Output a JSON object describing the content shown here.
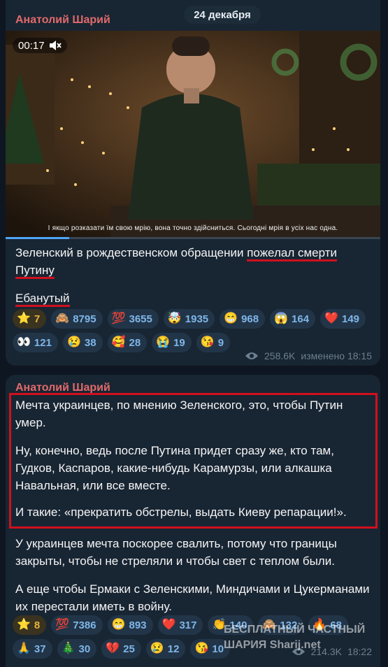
{
  "date": "24 декабря",
  "post1": {
    "sender": "Анатолий Шарий",
    "video_time": "00:17",
    "video_caption": "І якщо розказати їм свою мрію, вона точно здійсниться. Сьогодні мрія в усіх нас одна.",
    "text_a": "Зеленский в рождественском обращении ",
    "text_b": "пожелал смерти",
    "text_c": "Путину",
    "text_d": "Ебанутый",
    "reactions": [
      {
        "e": "⭐",
        "n": "7",
        "paid": true
      },
      {
        "e": "🙈",
        "n": "8795"
      },
      {
        "e": "💯",
        "n": "3655"
      },
      {
        "e": "🤯",
        "n": "1935"
      },
      {
        "e": "😁",
        "n": "968"
      },
      {
        "e": "😱",
        "n": "164"
      },
      {
        "e": "❤️",
        "n": "149"
      },
      {
        "e": "👀",
        "n": "121"
      },
      {
        "e": "😢",
        "n": "38"
      },
      {
        "e": "🥰",
        "n": "28"
      },
      {
        "e": "😭",
        "n": "19"
      },
      {
        "e": "😘",
        "n": "9"
      }
    ],
    "views": "258.6K",
    "edited": "изменено 18:15"
  },
  "post2": {
    "sender": "Анатолий Шарий",
    "p1": "Мечта украинцев, по мнению Зеленского, это, чтобы Путин умер.",
    "p2": "Ну, конечно, ведь после Путина придет сразу же, кто там, Гудков, Каспаров, какие-нибудь Карамурзы, или алкашка Навальная, или все вместе.",
    "p3": "И такие: «прекратить обстрелы, выдать Киеву репарации!».",
    "p4": "У украинцев мечта поскорее свалить, потому что границы закрыты, чтобы не стреляли и чтобы свет с теплом были.",
    "p5": "А еще чтобы Ермаки с Зеленскими, Миндичами и Цукерманами их перестали иметь в войну.",
    "reactions": [
      {
        "e": "⭐",
        "n": "8",
        "paid": true
      },
      {
        "e": "💯",
        "n": "7386"
      },
      {
        "e": "😁",
        "n": "893"
      },
      {
        "e": "❤️",
        "n": "317"
      },
      {
        "e": "👏",
        "n": "140"
      },
      {
        "e": "🙈",
        "n": "132"
      },
      {
        "e": "🔥",
        "n": "68"
      },
      {
        "e": "🙏",
        "n": "37"
      },
      {
        "e": "🎄",
        "n": "30"
      },
      {
        "e": "💔",
        "n": "25"
      },
      {
        "e": "😢",
        "n": "12"
      },
      {
        "e": "😘",
        "n": "10"
      }
    ],
    "views": "214.3K",
    "time": "18:22"
  },
  "watermark": {
    "line1": "БЕСПЛАТНЫЙ ЧАСТНЫЙ",
    "line2": "ШАРИЯ",
    "site": "Sharij.net"
  }
}
